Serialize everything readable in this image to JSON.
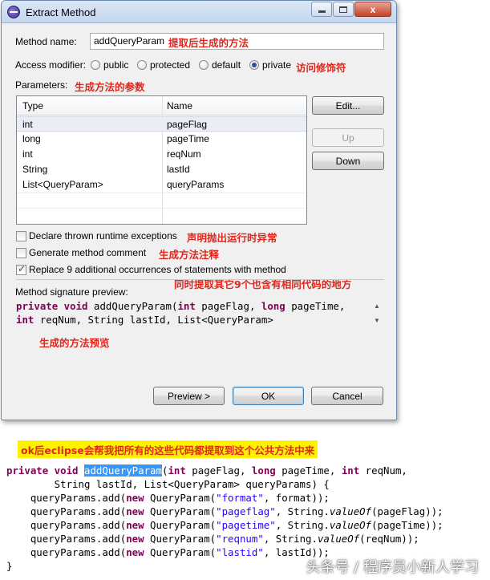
{
  "window": {
    "title": "Extract Method",
    "close_glyph": "x"
  },
  "method_name": {
    "label": "Method name:",
    "value": "addQueryParam",
    "annotation": "提取后生成的方法"
  },
  "access_modifier": {
    "label": "Access modifier:",
    "options": [
      "public",
      "protected",
      "default",
      "private"
    ],
    "selected": "private",
    "annotation": "访问修饰符"
  },
  "parameters": {
    "label": "Parameters:",
    "annotation": "生成方法的参数",
    "columns": [
      "Type",
      "Name"
    ],
    "rows": [
      {
        "type": "int",
        "name": "pageFlag"
      },
      {
        "type": "long",
        "name": "pageTime"
      },
      {
        "type": "int",
        "name": "reqNum"
      },
      {
        "type": "String",
        "name": "lastId"
      },
      {
        "type": "List<QueryParam>",
        "name": "queryParams"
      }
    ],
    "buttons": {
      "edit": "Edit...",
      "up": "Up",
      "down": "Down"
    }
  },
  "options": {
    "declare_exceptions": {
      "label": "Declare thrown runtime exceptions",
      "checked": false,
      "annotation": "声明抛出运行时异常"
    },
    "generate_comment": {
      "label": "Generate method comment",
      "checked": false,
      "annotation": "生成方法注释"
    },
    "replace": {
      "label": "Replace 9 additional occurrences of statements with method",
      "checked": true,
      "annotation": "同时提取其它9个也含有相同代码的地方"
    }
  },
  "preview": {
    "label": "Method signature preview:",
    "line1_kw": "private void",
    "line1_a": " addQueryParam(",
    "line1_kw2": "int",
    "line1_b": " pageFlag, ",
    "line1_kw3": "long",
    "line1_c": " pageTime,",
    "line2_kw": "int",
    "line2_rest": " reqNum, String lastId, List<QueryParam>",
    "annotation": "生成的方法预览"
  },
  "footer_buttons": {
    "preview": "Preview >",
    "ok": "OK",
    "cancel": "Cancel"
  },
  "banner": "ok后eclipse会帮我把所有的这些代码都提取到这个公共方法中来",
  "code": {
    "l1_kw": "private void",
    "l1_name": "addQueryParam",
    "l1_a": "(",
    "l1_int": "int",
    "l1_b": " pageFlag, ",
    "l1_long": "long",
    "l1_c": " pageTime, ",
    "l1_int2": "int",
    "l1_d": " reqNum,",
    "l2": "        String lastId, List<QueryParam> queryParams) {",
    "add_prefix": "    queryParams.add(",
    "new_kw": "new",
    "qp": " QueryParam(",
    "adds": [
      {
        "key": "\"format\"",
        "rest": ", format));"
      },
      {
        "key": "\"pageflag\"",
        "rest": ", String.",
        "method": "valueOf",
        "rest2": "(pageFlag));"
      },
      {
        "key": "\"pagetime\"",
        "rest": ", String.",
        "method": "valueOf",
        "rest2": "(pageTime));"
      },
      {
        "key": "\"reqnum\"",
        "rest": ", String.",
        "method": "valueOf",
        "rest2": "(reqNum));"
      },
      {
        "key": "\"lastid\"",
        "rest": ", lastId));"
      }
    ],
    "close": "}"
  },
  "watermark": "头条号 / 程序员小新人学习"
}
